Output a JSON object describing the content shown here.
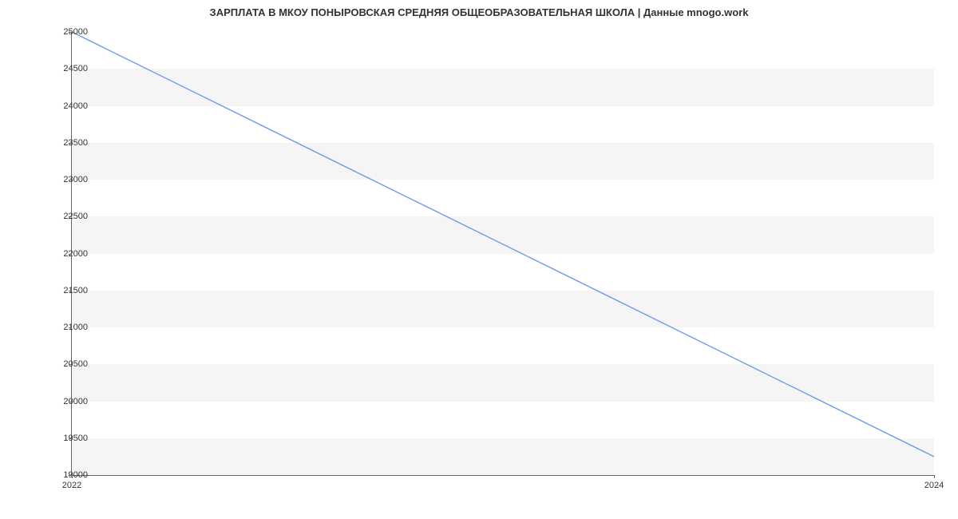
{
  "chart_data": {
    "type": "line",
    "title": "ЗАРПЛАТА В МКОУ ПОНЫРОВСКАЯ СРЕДНЯЯ ОБЩЕОБРАЗОВАТЕЛЬНАЯ ШКОЛА | Данные mnogo.work",
    "x": [
      2022,
      2024
    ],
    "values": [
      25000,
      19250
    ],
    "x_ticks": [
      2022,
      2024
    ],
    "y_ticks": [
      19000,
      19500,
      20000,
      20500,
      21000,
      21500,
      22000,
      22500,
      23000,
      23500,
      24000,
      24500,
      25000
    ],
    "xlim": [
      2022,
      2024
    ],
    "ylim": [
      19000,
      25000
    ],
    "xlabel": "",
    "ylabel": "",
    "line_color": "#6b9be8",
    "band_color": "#f5f5f5"
  }
}
